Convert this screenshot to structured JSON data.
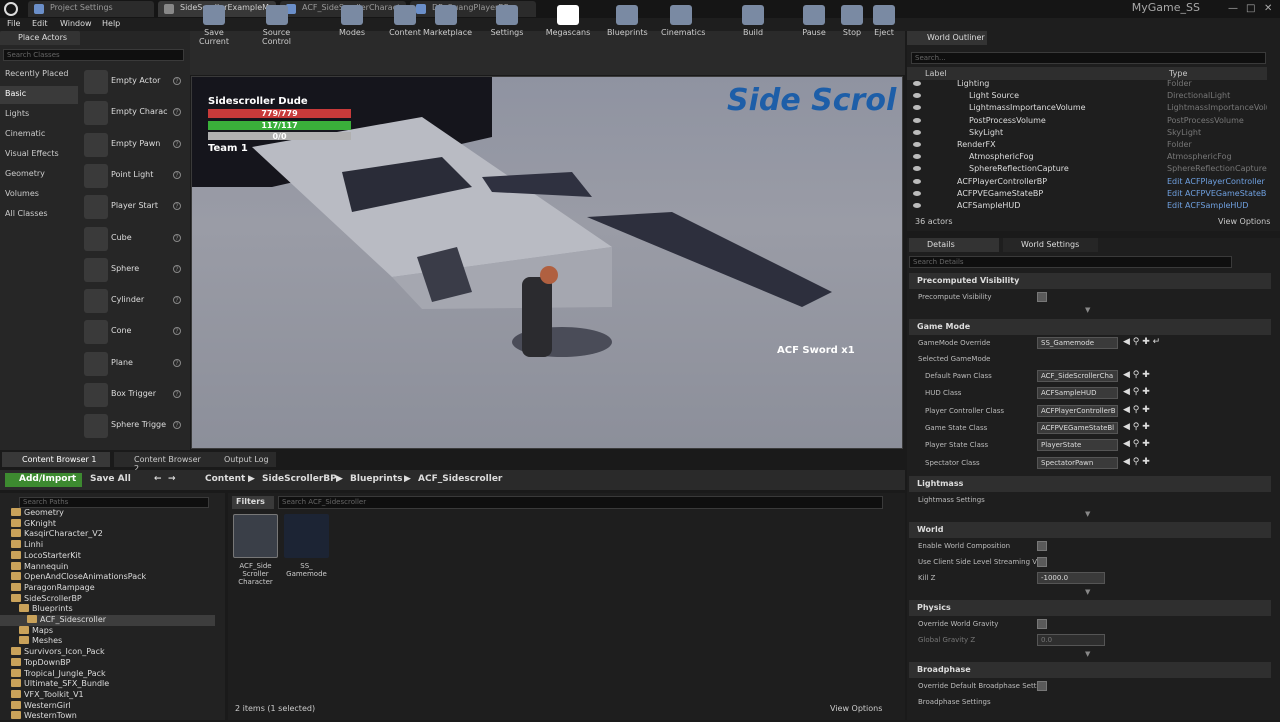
{
  "titlebar": {
    "tabs": [
      "Project Settings",
      "SideScrollerExampleMap*",
      "ACF_SideScrollerCharacte",
      "DP_QuangPlayerBP"
    ],
    "project_name": "MyGame_SS"
  },
  "menu": [
    "File",
    "Edit",
    "Window",
    "Help"
  ],
  "place_actors": {
    "tab": "Place Actors",
    "search_placeholder": "Search Classes",
    "categories": [
      "Recently Placed",
      "Basic",
      "Lights",
      "Cinematic",
      "Visual Effects",
      "Geometry",
      "Volumes",
      "All Classes"
    ],
    "selected_category": "Basic",
    "actors": [
      "Empty Actor",
      "Empty Charac",
      "Empty Pawn",
      "Point Light",
      "Player Start",
      "Cube",
      "Sphere",
      "Cylinder",
      "Cone",
      "Plane",
      "Box Trigger",
      "Sphere Trigge"
    ]
  },
  "toolbar": [
    "Save Current",
    "Source Control",
    "Modes",
    "Content",
    "Marketplace",
    "Settings",
    "Megascans",
    "Blueprints",
    "Cinematics",
    "Build",
    "Pause",
    "Stop",
    "Eject"
  ],
  "viewport": {
    "character_name": "Sidescroller Dude",
    "health": "779/779",
    "stamina": "117/117",
    "third": "0/0",
    "team": "Team 1",
    "pickup": "ACF Sword x1",
    "level_text": "Side Scrol"
  },
  "outliner": {
    "tab": "World Outliner",
    "search_placeholder": "Search...",
    "col_label": "Label",
    "col_type": "Type",
    "rows": [
      {
        "label": "Lighting",
        "type": "Folder"
      },
      {
        "label": "Light Source",
        "type": "DirectionalLight"
      },
      {
        "label": "LightmassImportanceVolume",
        "type": "LightmassImportanceVolur"
      },
      {
        "label": "PostProcessVolume",
        "type": "PostProcessVolume"
      },
      {
        "label": "SkyLight",
        "type": "SkyLight"
      },
      {
        "label": "RenderFX",
        "type": "Folder"
      },
      {
        "label": "AtmosphericFog",
        "type": "AtmosphericFog"
      },
      {
        "label": "SphereReflectionCapture",
        "type": "SphereReflectionCapture"
      },
      {
        "label": "ACFPlayerControllerBP",
        "type": "Edit ACFPlayerController"
      },
      {
        "label": "ACFPVEGameStateBP",
        "type": "Edit ACFPVEGameStateBl"
      },
      {
        "label": "ACFSampleHUD",
        "type": "Edit ACFSampleHUD"
      }
    ],
    "count": "36 actors",
    "view_options": "View Options"
  },
  "details": {
    "tab1": "Details",
    "tab2": "World Settings",
    "search_placeholder": "Search Details",
    "precomputed": {
      "title": "Precomputed Visibility",
      "prop": "Precompute Visibility"
    },
    "gamemode": {
      "title": "Game Mode",
      "override_label": "GameMode Override",
      "override_value": "SS_Gamemode",
      "selected": "Selected GameMode",
      "props": [
        {
          "label": "Default Pawn Class",
          "value": "ACF_SideScrollerCha"
        },
        {
          "label": "HUD Class",
          "value": "ACFSampleHUD"
        },
        {
          "label": "Player Controller Class",
          "value": "ACFPlayerControllerB"
        },
        {
          "label": "Game State Class",
          "value": "ACFPVEGameStateBl"
        },
        {
          "label": "Player State Class",
          "value": "PlayerState"
        },
        {
          "label": "Spectator Class",
          "value": "SpectatorPawn"
        }
      ]
    },
    "lightmass": {
      "title": "Lightmass",
      "prop": "Lightmass Settings"
    },
    "world": {
      "title": "World",
      "props": [
        "Enable World Composition",
        "Use Client Side Level Streaming Vi",
        "Kill Z"
      ],
      "killz": "-1000.0"
    },
    "physics": {
      "title": "Physics",
      "props": [
        "Override World Gravity",
        "Global Gravity Z"
      ],
      "gravity": "0.0"
    },
    "broadphase": {
      "title": "Broadphase",
      "props": [
        "Override Default Broadphase Settin",
        "Broadphase Settings"
      ]
    }
  },
  "content_browser": {
    "tabs": [
      "Content Browser 1",
      "Content Browser 2",
      "Output Log"
    ],
    "add_import": "Add/Import",
    "save_all": "Save All",
    "breadcrumb": [
      "Content",
      "SideScrollerBP",
      "Blueprints",
      "ACF_Sidescroller"
    ],
    "path_placeholder": "Search Paths",
    "folders": [
      {
        "name": "Geometry",
        "indent": 0
      },
      {
        "name": "GKnight",
        "indent": 0
      },
      {
        "name": "KasqirCharacter_V2",
        "indent": 0
      },
      {
        "name": "Linhi",
        "indent": 0
      },
      {
        "name": "LocoStarterKit",
        "indent": 0
      },
      {
        "name": "Mannequin",
        "indent": 0
      },
      {
        "name": "OpenAndCloseAnimationsPack",
        "indent": 0
      },
      {
        "name": "ParagonRampage",
        "indent": 0
      },
      {
        "name": "SideScrollerBP",
        "indent": 0
      },
      {
        "name": "Blueprints",
        "indent": 1
      },
      {
        "name": "ACF_Sidescroller",
        "indent": 2
      },
      {
        "name": "Maps",
        "indent": 1
      },
      {
        "name": "Meshes",
        "indent": 1
      },
      {
        "name": "Survivors_Icon_Pack",
        "indent": 0
      },
      {
        "name": "TopDownBP",
        "indent": 0
      },
      {
        "name": "Tropical_Jungle_Pack",
        "indent": 0
      },
      {
        "name": "Ultimate_SFX_Bundle",
        "indent": 0
      },
      {
        "name": "VFX_Toolkit_V1",
        "indent": 0
      },
      {
        "name": "WesternGirl",
        "indent": 0
      },
      {
        "name": "WesternTown",
        "indent": 0
      }
    ],
    "filters": "Filters",
    "search_placeholder": "Search ACF_Sidescroller",
    "assets": [
      {
        "name": "ACF_Side Scroller Character"
      },
      {
        "name": "SS_ Gamemode"
      }
    ],
    "status": "2 items (1 selected)",
    "view_options": "View Options"
  },
  "colors": {
    "health": "#c83a3a",
    "stamina": "#3ab03a",
    "third": "#b0b0b0",
    "accent": "#3d8a30",
    "link": "#6fa0e0"
  }
}
